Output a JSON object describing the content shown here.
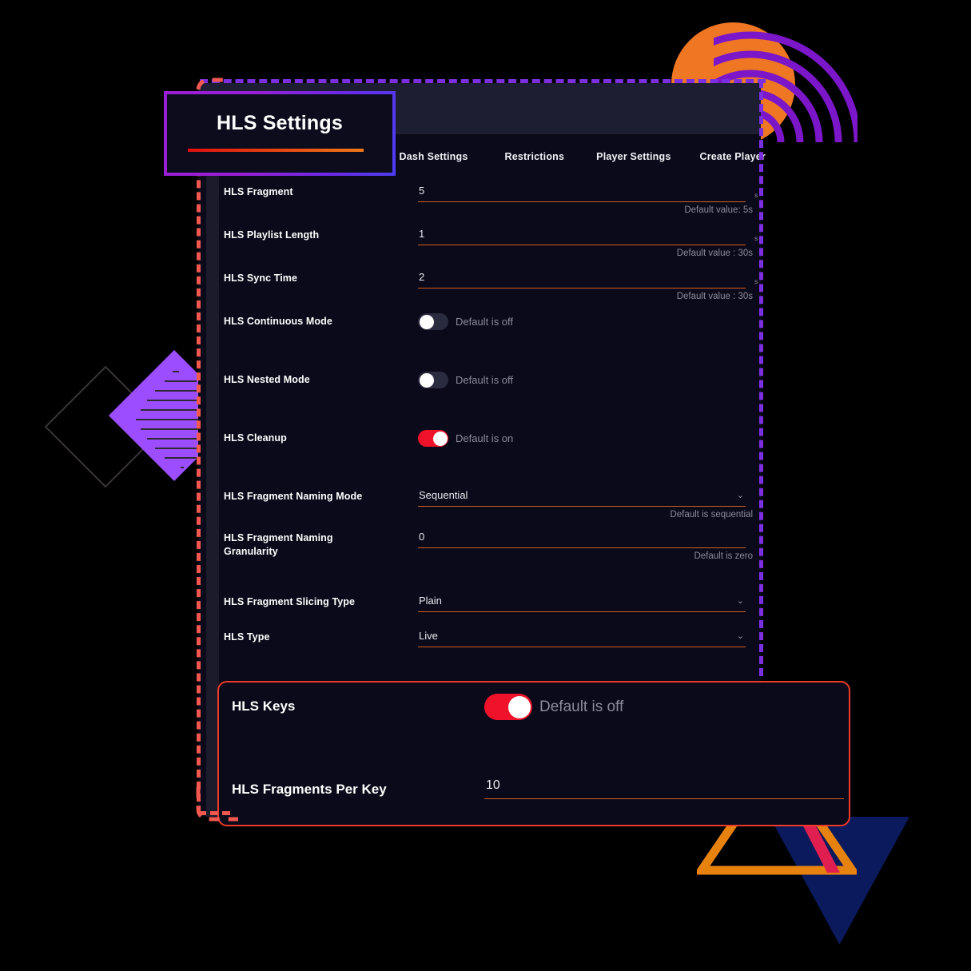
{
  "title_card": {
    "heading": "HLS Settings"
  },
  "nav": {
    "tabs": [
      {
        "label": "Dash Settings"
      },
      {
        "label": "Restrictions"
      },
      {
        "label": "Player Settings"
      },
      {
        "label": "Create Player"
      }
    ]
  },
  "form": {
    "rows": [
      {
        "type": "text",
        "label": "HLS Fragment",
        "value": "5",
        "unit": "s",
        "hint": "Default value: 5s"
      },
      {
        "type": "text",
        "label": "HLS Playlist Length",
        "value": "1",
        "unit": "s",
        "hint": "Default value : 30s"
      },
      {
        "type": "text",
        "label": "HLS Sync Time",
        "value": "2",
        "unit": "s",
        "hint": "Default value : 30s"
      },
      {
        "type": "toggle",
        "label": "HLS Continuous Mode",
        "state": "off",
        "toggle_label": "Default is off"
      },
      {
        "type": "toggle",
        "label": "HLS Nested Mode",
        "state": "off",
        "toggle_label": "Default is off"
      },
      {
        "type": "toggle",
        "label": "HLS Cleanup",
        "state": "on",
        "toggle_label": "Default is on"
      },
      {
        "type": "select",
        "label": "HLS Fragment Naming Mode",
        "value": "Sequential",
        "hint": "Default is sequential",
        "caret": "⌄"
      },
      {
        "type": "text",
        "label": "HLS Fragment Naming Granularity",
        "value": "0",
        "hint": "Default is zero"
      },
      {
        "type": "select",
        "label": "HLS Fragment Slicing Type",
        "value": "Plain",
        "caret": "⌄"
      },
      {
        "type": "select",
        "label": "HLS Type",
        "value": "Live",
        "caret": "⌄"
      }
    ]
  },
  "keys_panel": {
    "keys_label": "HLS Keys",
    "keys_toggle_state": "on",
    "keys_toggle_label": "Default is off",
    "fragments_label": "HLS Fragments Per Key",
    "fragments_value": "10"
  },
  "colors": {
    "accent_red": "#f0122a",
    "accent_orange": "#d4601f",
    "accent_purple": "#7b2fe0",
    "highlight_border": "#ef3a2a",
    "panel_bg": "#0a0a1a",
    "topbar_bg": "#1e1e33"
  }
}
